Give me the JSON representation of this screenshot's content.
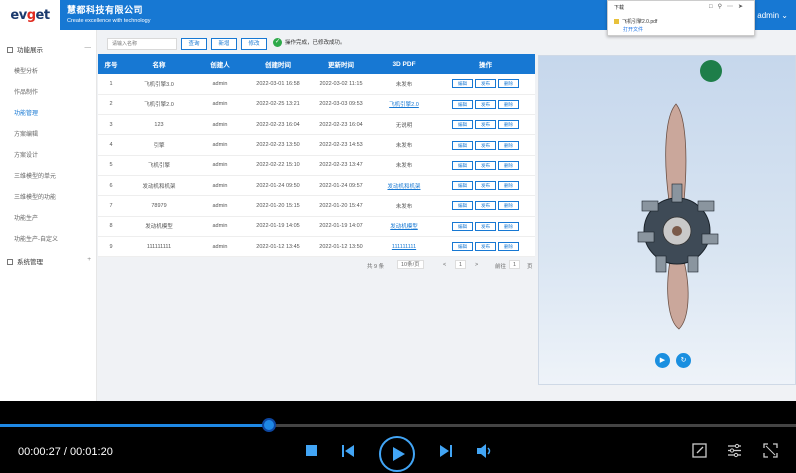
{
  "header": {
    "logo": "evget",
    "company_cn": "慧都科技有限公司",
    "company_en": "Create excellence with technology",
    "user": "admin"
  },
  "download_popup": {
    "title": "下载",
    "file_name": "飞机引擎2.0.pdf",
    "open_link": "打开文件"
  },
  "sidebar": {
    "groups": [
      {
        "label": "功能展示",
        "toggle": "—"
      },
      {
        "label": "系统管理",
        "toggle": "+"
      }
    ],
    "items": [
      {
        "label": "模型分析"
      },
      {
        "label": "作品制作"
      },
      {
        "label": "功能管理"
      },
      {
        "label": "方案编辑"
      },
      {
        "label": "方案设计"
      },
      {
        "label": "三维模型的单元"
      },
      {
        "label": "三维模型的功能"
      },
      {
        "label": "功能生产"
      },
      {
        "label": "功能生产-自定义"
      }
    ]
  },
  "toolbar": {
    "search_placeholder": "请输入名称",
    "query": "查询",
    "add": "新增",
    "edit": "修改",
    "tip": "操作完成，已修改成功。"
  },
  "table": {
    "headers": [
      "序号",
      "名称",
      "创建人",
      "创建时间",
      "更新时间",
      "3D PDF",
      "操作"
    ],
    "rows": [
      {
        "no": "1",
        "name": "飞机引擎3.0",
        "creator": "admin",
        "created": "2022-03-01 16:58",
        "updated": "2022-03-02 11:15",
        "pdf": "未发布",
        "pdf_link": false
      },
      {
        "no": "2",
        "name": "飞机引擎2.0",
        "creator": "admin",
        "created": "2022-02-25 13:21",
        "updated": "2022-03-03 09:53",
        "pdf": "飞机引擎2.0",
        "pdf_link": true
      },
      {
        "no": "3",
        "name": "123",
        "creator": "admin",
        "created": "2022-02-23 16:04",
        "updated": "2022-02-23 16:04",
        "pdf": "无说明",
        "pdf_link": false
      },
      {
        "no": "4",
        "name": "引擎",
        "creator": "admin",
        "created": "2022-02-23 13:50",
        "updated": "2022-02-23 14:53",
        "pdf": "未发布",
        "pdf_link": false
      },
      {
        "no": "5",
        "name": "飞机引擎",
        "creator": "admin",
        "created": "2022-02-22 15:10",
        "updated": "2022-02-23 13:47",
        "pdf": "未发布",
        "pdf_link": false
      },
      {
        "no": "6",
        "name": "发动机和机架",
        "creator": "admin",
        "created": "2022-01-24 09:50",
        "updated": "2022-01-24 09:57",
        "pdf": "发动机和机架",
        "pdf_link": true
      },
      {
        "no": "7",
        "name": "78979",
        "creator": "admin",
        "created": "2022-01-20 15:15",
        "updated": "2022-01-20 15:47",
        "pdf": "未发布",
        "pdf_link": false
      },
      {
        "no": "8",
        "name": "发动机模型",
        "creator": "admin",
        "created": "2022-01-19 14:05",
        "updated": "2022-01-19 14:07",
        "pdf": "发动机模型",
        "pdf_link": true
      },
      {
        "no": "9",
        "name": "111111111",
        "creator": "admin",
        "created": "2022-01-12 13:45",
        "updated": "2022-01-12 13:50",
        "pdf": "111111111",
        "pdf_link": true
      }
    ],
    "actions": [
      "编辑",
      "发布",
      "删除"
    ]
  },
  "pager": {
    "total": "共 9 条",
    "page_size": "10条/页",
    "prev": "<",
    "current": "1",
    "next": ">",
    "goto_label": "前往",
    "goto_value": "1",
    "page_suffix": "页"
  },
  "player": {
    "time": "00:00:27 / 00:01:20",
    "progress": 0.3375
  }
}
